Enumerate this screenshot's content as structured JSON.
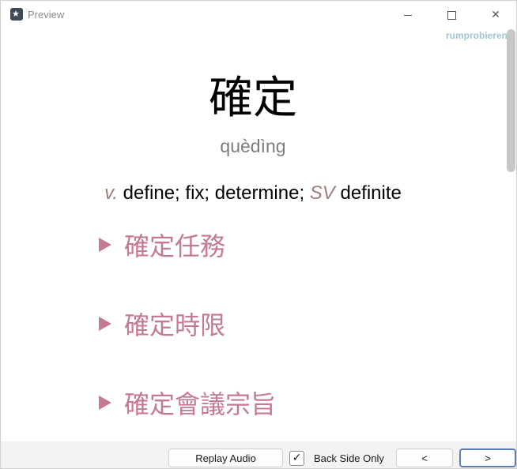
{
  "window": {
    "title": "Preview",
    "icon": "anki-star-icon"
  },
  "window_controls": {
    "minimize": "minimize-icon",
    "maximize": "maximize-icon",
    "close_glyph": "✕"
  },
  "overflow_text": "rumprobieren",
  "card": {
    "hanzi": "確定",
    "pinyin": "quèdìng",
    "definition": {
      "pos1": "v.",
      "meaning1": " define; fix; determine; ",
      "pos2": "SV",
      "meaning2": " definite"
    },
    "examples": [
      "確定任務",
      "確定時限",
      "確定會議宗旨"
    ],
    "accent_color": "#c47a90"
  },
  "bottom_bar": {
    "replay_label": "Replay Audio",
    "back_side_checked": true,
    "check_glyph": "✓",
    "back_side_label": "Back Side Only",
    "prev_label": "<",
    "next_label": ">"
  }
}
